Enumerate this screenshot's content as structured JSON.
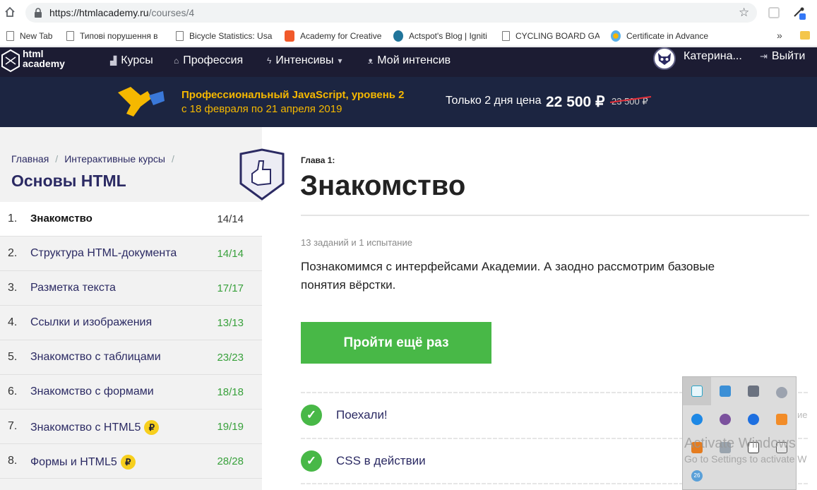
{
  "browser": {
    "url_host": "https://htmlacademy.ru",
    "url_path": "/courses/4",
    "bookmarks": [
      {
        "label": "New Tab"
      },
      {
        "label": "Типові порушення в"
      },
      {
        "label": "Bicycle Statistics: Usa"
      },
      {
        "label": "Academy for Creative"
      },
      {
        "label": "Actspot's Blog | Igniti"
      },
      {
        "label": "CYCLING BOARD GAI"
      },
      {
        "label": "Certificate in Advance"
      }
    ],
    "more": "»"
  },
  "nav": {
    "logo_line1": "html",
    "logo_line2": "academy",
    "items": [
      {
        "label": "Курсы"
      },
      {
        "label": "Профессия"
      },
      {
        "label": "Интенсивы"
      },
      {
        "label": "Мой интенсив"
      }
    ],
    "user_name": "Катерина...",
    "logout": "Выйти"
  },
  "promo": {
    "title": "Профессиональный JavaScript, уровень 2",
    "dates": "с 18 февраля по 21 апреля 2019",
    "offer": "Только 2 дня цена",
    "price": "22 500 ₽",
    "old_price": "23 500 ₽"
  },
  "sidebar": {
    "breadcrumbs": [
      "Главная",
      "Интерактивные курсы"
    ],
    "title": "Основы HTML",
    "lessons": [
      {
        "num": "1.",
        "name": "Знакомство",
        "count": "14/14",
        "paid": false
      },
      {
        "num": "2.",
        "name": "Структура HTML-документа",
        "count": "14/14",
        "paid": false
      },
      {
        "num": "3.",
        "name": "Разметка текста",
        "count": "17/17",
        "paid": false
      },
      {
        "num": "4.",
        "name": "Ссылки и изображения",
        "count": "13/13",
        "paid": false
      },
      {
        "num": "5.",
        "name": "Знакомство с таблицами",
        "count": "23/23",
        "paid": false
      },
      {
        "num": "6.",
        "name": "Знакомство с формами",
        "count": "18/18",
        "paid": false
      },
      {
        "num": "7.",
        "name": "Знакомство с HTML5",
        "count": "19/19",
        "paid": true
      },
      {
        "num": "8.",
        "name": "Формы и HTML5",
        "count": "28/28",
        "paid": true
      }
    ],
    "paid_badge": "₽"
  },
  "main": {
    "chapter_label": "Глава 1:",
    "chapter_title": "Знакомство",
    "meta": "13 заданий и 1 испытание",
    "description": "Познакомимся с интерфейсами Академии. А заодно рассмотрим базовые понятия вёрстки.",
    "primary_button": "Пройти ещё раз",
    "steps": [
      {
        "label": "Поехали!"
      },
      {
        "label": "CSS в действии"
      }
    ],
    "step_icon": "✓"
  },
  "overlay": {
    "watermark_line1": "Activate Windows",
    "watermark_line2": "Go to Settings to activate W",
    "edge_text": "ие",
    "badge_count": "26"
  },
  "colors": {
    "nav_bg": "#1c1c33",
    "promo_bg": "#1c2541",
    "promo_accent": "#f5b800",
    "accent_green": "#48b847",
    "title_blue": "#2b2a63"
  }
}
